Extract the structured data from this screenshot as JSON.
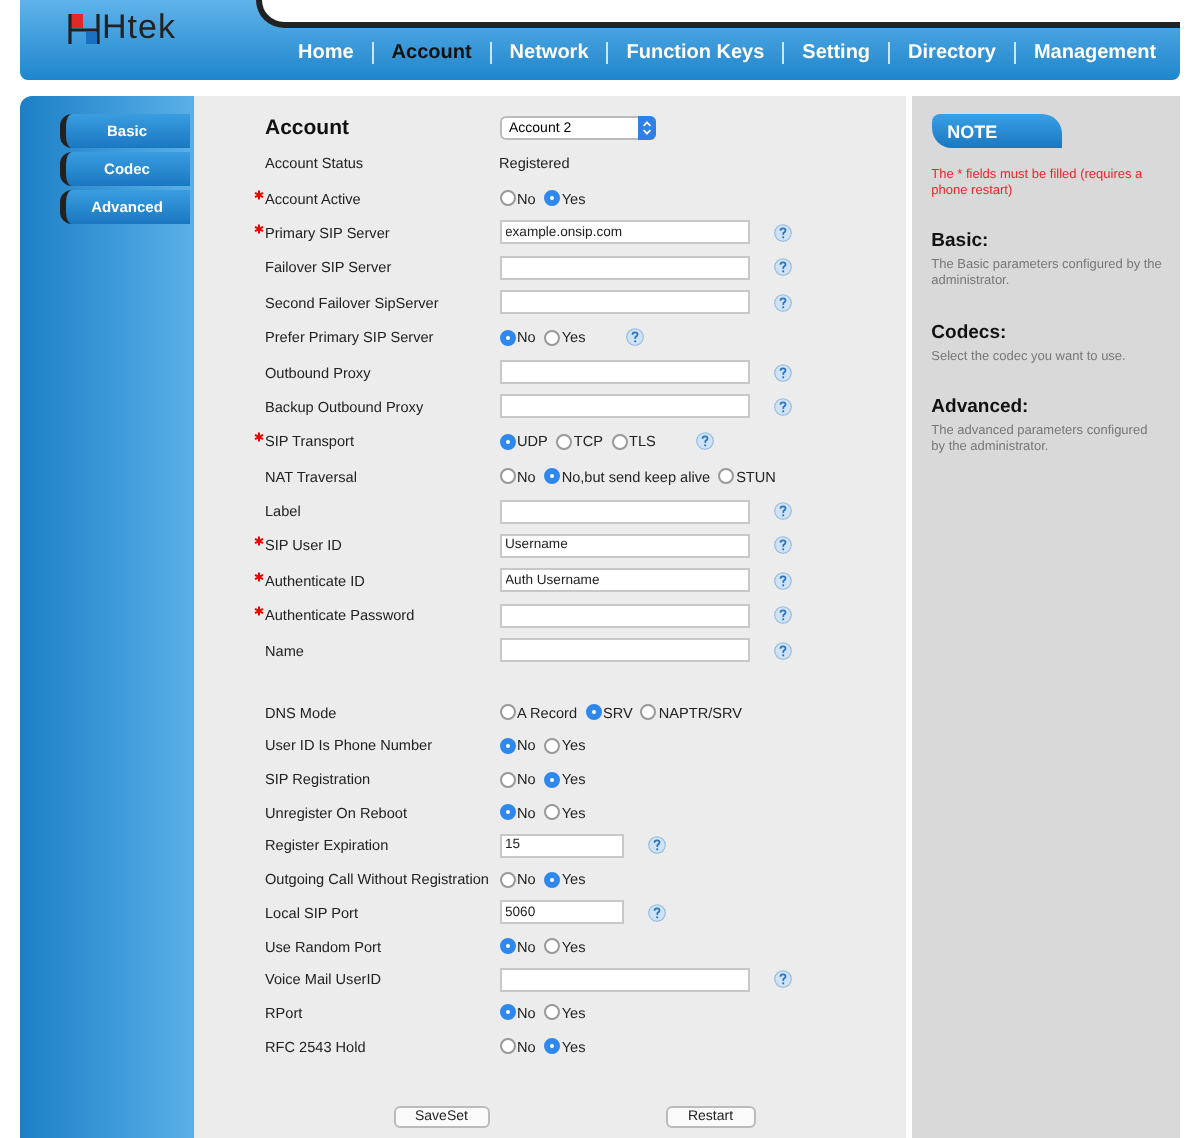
{
  "header": {
    "logo": "Htek",
    "nav": [
      {
        "label": "Home",
        "selected": false
      },
      {
        "label": "Account",
        "selected": true
      },
      {
        "label": "Network",
        "selected": false
      },
      {
        "label": "Function Keys",
        "selected": false
      },
      {
        "label": "Setting",
        "selected": false
      },
      {
        "label": "Directory",
        "selected": false
      },
      {
        "label": "Management",
        "selected": false
      }
    ]
  },
  "sidebar": {
    "items": [
      {
        "label": "Basic"
      },
      {
        "label": "Codec"
      },
      {
        "label": "Advanced"
      }
    ]
  },
  "form": {
    "title": "Account",
    "account_select": "Account 2",
    "rows": [
      {
        "kind": "text",
        "label": "Account Status",
        "required": false,
        "value": "Registered",
        "help": false
      },
      {
        "kind": "radio",
        "label": "Account Active",
        "required": true,
        "help": false,
        "options": [
          {
            "label": "No",
            "selected": false
          },
          {
            "label": "Yes",
            "selected": true
          }
        ]
      },
      {
        "kind": "input",
        "label": "Primary SIP Server",
        "required": true,
        "value": "example.onsip.com",
        "help": true
      },
      {
        "kind": "input",
        "label": "Failover SIP Server",
        "required": false,
        "help": true
      },
      {
        "kind": "input",
        "label": "Second Failover SipServer",
        "required": false,
        "help": true
      },
      {
        "kind": "radio",
        "label": "Prefer Primary SIP Server",
        "required": false,
        "help": true,
        "options": [
          {
            "label": "No",
            "selected": true
          },
          {
            "label": "Yes",
            "selected": false
          }
        ]
      },
      {
        "kind": "input",
        "label": "Outbound Proxy",
        "required": false,
        "help": true
      },
      {
        "kind": "input",
        "label": "Backup Outbound Proxy",
        "required": false,
        "help": true
      },
      {
        "kind": "radio",
        "label": "SIP Transport",
        "required": true,
        "help": true,
        "options": [
          {
            "label": "UDP",
            "selected": true
          },
          {
            "label": "TCP",
            "selected": false
          },
          {
            "label": "TLS",
            "selected": false
          }
        ]
      },
      {
        "kind": "radio",
        "label": "NAT Traversal",
        "required": false,
        "help": false,
        "options": [
          {
            "label": "No",
            "selected": false
          },
          {
            "label": "No,but send keep alive",
            "selected": true
          },
          {
            "label": "STUN",
            "selected": false
          }
        ]
      },
      {
        "kind": "input",
        "label": "Label",
        "required": false,
        "help": true
      },
      {
        "kind": "input",
        "label": "SIP User ID",
        "required": true,
        "value": "Username",
        "help": true
      },
      {
        "kind": "input",
        "label": "Authenticate ID",
        "required": true,
        "value": "Auth Username",
        "help": true
      },
      {
        "kind": "input",
        "label": "Authenticate Password",
        "required": true,
        "help": true
      },
      {
        "kind": "input",
        "label": "Name",
        "required": false,
        "help": true
      },
      {
        "kind": "spacer"
      },
      {
        "kind": "radio",
        "label": "DNS Mode",
        "required": false,
        "help": false,
        "options": [
          {
            "label": "A Record",
            "selected": false
          },
          {
            "label": "SRV",
            "selected": true
          },
          {
            "label": "NAPTR/SRV",
            "selected": false
          }
        ]
      },
      {
        "kind": "radio",
        "label": "User ID Is Phone Number",
        "required": false,
        "help": false,
        "options": [
          {
            "label": "No",
            "selected": true
          },
          {
            "label": "Yes",
            "selected": false
          }
        ]
      },
      {
        "kind": "radio",
        "label": "SIP Registration",
        "required": false,
        "help": false,
        "options": [
          {
            "label": "No",
            "selected": false
          },
          {
            "label": "Yes",
            "selected": true
          }
        ]
      },
      {
        "kind": "radio",
        "label": "Unregister On Reboot",
        "required": false,
        "help": false,
        "options": [
          {
            "label": "No",
            "selected": true
          },
          {
            "label": "Yes",
            "selected": false
          }
        ]
      },
      {
        "kind": "short-input",
        "label": "Register Expiration",
        "required": false,
        "value": "15",
        "help": true
      },
      {
        "kind": "radio",
        "label": "Outgoing Call Without Registration",
        "required": false,
        "help": false,
        "options": [
          {
            "label": "No",
            "selected": false
          },
          {
            "label": "Yes",
            "selected": true
          }
        ]
      },
      {
        "kind": "short-input",
        "label": "Local SIP Port",
        "required": false,
        "value": "5060",
        "help": true
      },
      {
        "kind": "radio",
        "label": "Use Random Port",
        "required": false,
        "help": false,
        "options": [
          {
            "label": "No",
            "selected": true
          },
          {
            "label": "Yes",
            "selected": false
          }
        ]
      },
      {
        "kind": "input",
        "label": "Voice Mail UserID",
        "required": false,
        "help": true
      },
      {
        "kind": "radio",
        "label": "RPort",
        "required": false,
        "help": false,
        "options": [
          {
            "label": "No",
            "selected": true
          },
          {
            "label": "Yes",
            "selected": false
          }
        ]
      },
      {
        "kind": "radio",
        "label": "RFC 2543 Hold",
        "required": false,
        "help": false,
        "options": [
          {
            "label": "No",
            "selected": false
          },
          {
            "label": "Yes",
            "selected": true
          }
        ]
      }
    ],
    "buttons": [
      "SaveSet",
      "Restart"
    ]
  },
  "note": {
    "title": "NOTE",
    "warning": "The * fields must be filled (requires a phone restart)",
    "sections": [
      {
        "heading": "Basic:",
        "text": "The Basic parameters configured by the administrator."
      },
      {
        "heading": "Codecs:",
        "text": "Select the codec you want to use."
      },
      {
        "heading": "Advanced:",
        "text": "The advanced parameters configured by the administrator."
      }
    ]
  }
}
